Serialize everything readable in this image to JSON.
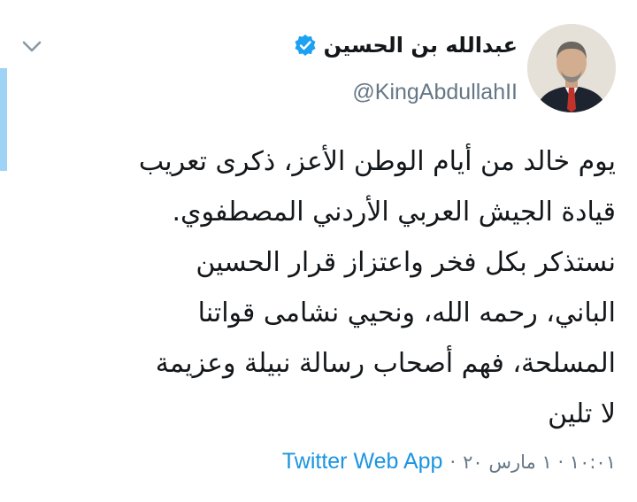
{
  "colors": {
    "accent": "#1da1f2",
    "accent_bar": "#9fd3f5",
    "text": "#14171a",
    "secondary": "#657786",
    "link": "#1b95e0"
  },
  "tweet": {
    "author": {
      "display_name": "عبدالله بن الحسين",
      "handle": "@KingAbdullahII",
      "verified": true,
      "verified_icon": "verified-badge-icon",
      "avatar_icon": "avatar"
    },
    "menu_icon": "chevron-down-icon",
    "text_lines": [
      "يوم خالد من أيام الوطن الأعز، ذكرى تعريب",
      "قيادة الجيش العربي الأردني المصطفوي.",
      "نستذكر بكل فخر واعتزاز قرار الحسين",
      "الباني، رحمه الله، ونحيي نشامى قواتنا",
      "المسلحة، فهم أصحاب رسالة نبيلة وعزيمة",
      "لا تلين"
    ],
    "timestamp": "١٠:٠١ · ١ مارس ٢٠",
    "separator": "·",
    "source": "Twitter Web App"
  }
}
